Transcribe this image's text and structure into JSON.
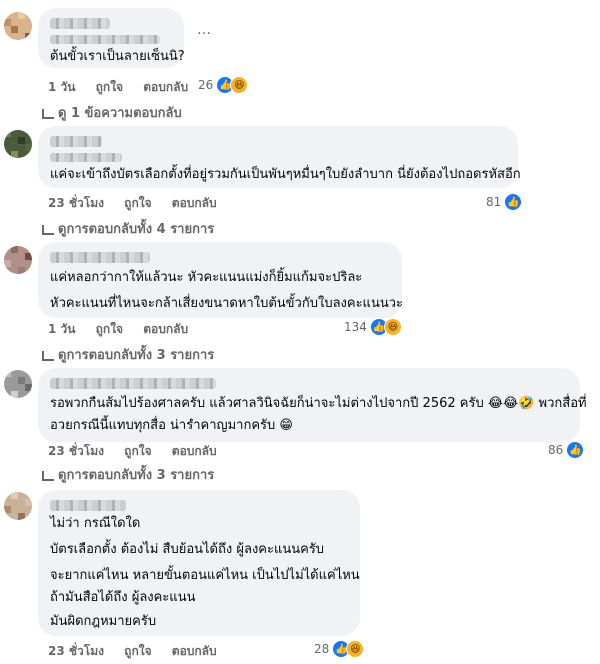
{
  "comments": [
    {
      "text_lines": [
        "ต้นขั้วเราเป็นลายเซ็นนิ?"
      ],
      "time": "1 วัน",
      "like": "ถูกใจ",
      "reply": "ตอบกลับ",
      "reaction_count": "26",
      "reply_link": "ดู 1 ข้อความตอบกลับ"
    },
    {
      "text_lines": [
        "แค่จะเข้าถึงบัตรเลือกตั้งที่อยู่รวมกันเป็นพันๆหมื่นๆใบยังลำบาก นี่ยังต้องไปถอดรหัสอีก"
      ],
      "time": "23 ชั่วโมง",
      "like": "ถูกใจ",
      "reply": "ตอบกลับ",
      "reaction_count": "81",
      "reply_link": "ดูการตอบกลับทั้ง 4 รายการ"
    },
    {
      "text_lines": [
        "แค่หลอกว่ากาให้แล้วนะ หัวคะแนนแม่งก็ยิ้มแก้มจะปริละ",
        "หัวคะแนนที่ไหนจะกล้าเสี่ยงขนาดหาใบต้นขั้วกับใบลงคะแนนวะ"
      ],
      "time": "1 วัน",
      "like": "ถูกใจ",
      "reply": "ตอบกลับ",
      "reaction_count": "134",
      "reply_link": "ดูการตอบกลับทั้ง 3 รายการ"
    },
    {
      "text_lines": [
        "รอพวกกืนส้มไปร้องศาลครับ แล้วศาลวินิจฉัยก็น่าจะไม่ต่างไปจากปี 2562 ครับ 😂😂🤣 พวกสื่อที่",
        "อวยกรณีนี้แทบทุกสื่อ น่ารำคาญมากครับ 😁"
      ],
      "time": "23 ชั่วโมง",
      "like": "ถูกใจ",
      "reply": "ตอบกลับ",
      "reaction_count": "86",
      "reply_link": "ดูการตอบกลับทั้ง 3 รายการ"
    },
    {
      "text_lines": [
        "ไม่ว่า กรณีใดใด",
        "บัตรเลือกตั้ง ต้องไม่ สืบย้อนได้ถึง ผู้ลงคะแนนครับ",
        "จะยากแค่ไหน หลายขั้นตอนแค่ไหน เป็นไปไม่ได้แค่ไหน",
        "ถ้ามันสือได้ถึง ผู้ลงคะแนน",
        "มันผิดกฎหมายครับ"
      ],
      "time": "23 ชั่วโมง",
      "like": "ถูกใจ",
      "reply": "ตอบกลับ",
      "reaction_count": "28",
      "reply_link": ""
    }
  ],
  "icons": {
    "like": "like-icon",
    "haha": "haha-icon",
    "more": "more-options-icon"
  }
}
